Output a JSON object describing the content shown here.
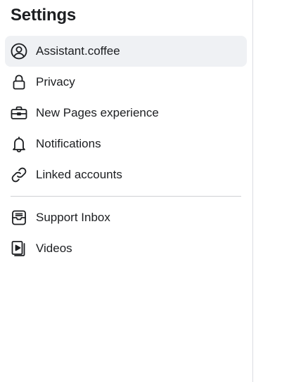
{
  "sidebar": {
    "title": "Settings",
    "items": [
      {
        "label": "Assistant.coffee",
        "icon": "user-circle-icon",
        "active": true
      },
      {
        "label": "Privacy",
        "icon": "lock-icon",
        "active": false
      },
      {
        "label": "New Pages experience",
        "icon": "briefcase-icon",
        "active": false
      },
      {
        "label": "Notifications",
        "icon": "bell-icon",
        "active": false
      },
      {
        "label": "Linked accounts",
        "icon": "link-icon",
        "active": false
      }
    ],
    "items_secondary": [
      {
        "label": "Support Inbox",
        "icon": "inbox-icon",
        "active": false
      },
      {
        "label": "Videos",
        "icon": "video-file-icon",
        "active": false
      }
    ]
  },
  "colors": {
    "active_background": "#eff1f4",
    "text": "#1c1e21",
    "divider": "#ced0d4"
  }
}
